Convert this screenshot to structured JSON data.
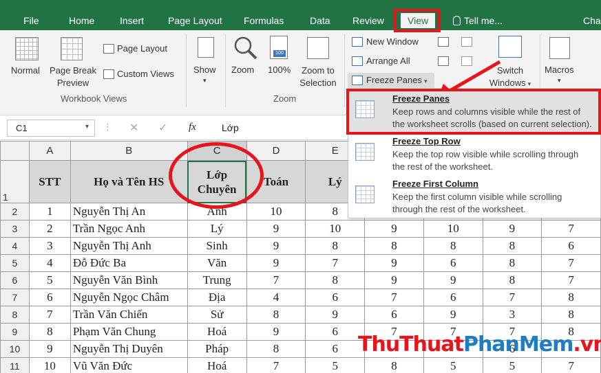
{
  "ribbon_tabs": [
    {
      "label": "File"
    },
    {
      "label": "Home"
    },
    {
      "label": "Insert"
    },
    {
      "label": "Page Layout"
    },
    {
      "label": "Formulas"
    },
    {
      "label": "Data"
    },
    {
      "label": "Review"
    },
    {
      "label": "View"
    },
    {
      "label": "Tell me..."
    },
    {
      "label": "Cha"
    }
  ],
  "workbook_views": {
    "normal": "Normal",
    "page_break_preview_line1": "Page Break",
    "page_break_preview_line2": "Preview",
    "page_layout": "Page Layout",
    "custom_views": "Custom Views",
    "group_label": "Workbook Views"
  },
  "show_group": {
    "show": "Show"
  },
  "zoom_group": {
    "zoom": "Zoom",
    "zoom_100": "100%",
    "zoom_to_selection_line1": "Zoom to",
    "zoom_to_selection_line2": "Selection",
    "group_label": "Zoom",
    "badge_100": "100"
  },
  "window_group": {
    "new_window": "New Window",
    "arrange_all": "Arrange All",
    "freeze_panes": "Freeze Panes",
    "switch_windows_line1": "Switch",
    "switch_windows_line2": "Windows"
  },
  "macros_group": {
    "macros": "Macros"
  },
  "formula_bar": {
    "name_box": "C1",
    "fx_label": "fx",
    "formula_value": "Lớp"
  },
  "freeze_menu": {
    "items": [
      {
        "title": "Freeze Panes",
        "desc1": "Keep rows and columns visible while the rest of",
        "desc2": "the worksheet scrolls (based on current selection)."
      },
      {
        "title": "Freeze Top Row",
        "desc1": "Keep the top row visible while scrolling through",
        "desc2": "the rest of the worksheet."
      },
      {
        "title": "Freeze First Column",
        "desc1": "Keep the first column visible while scrolling",
        "desc2": "through the rest of the worksheet."
      }
    ]
  },
  "sheet": {
    "columns": [
      "A",
      "B",
      "C",
      "D",
      "E",
      "F",
      "G",
      "H",
      "I"
    ],
    "header_row": {
      "stt": "STT",
      "name": "Họ và Tên HS",
      "class_line1": "Lớp",
      "class_line2": "Chuyên",
      "math": "Toán",
      "physics": "Lý"
    },
    "rows": [
      {
        "num": "2",
        "stt": "1",
        "name": "Nguyễn Thị An",
        "cls": "Anh",
        "d": "10",
        "e": "8",
        "f": "",
        "g": "",
        "h": "",
        "i": ""
      },
      {
        "num": "3",
        "stt": "2",
        "name": "Trần Ngọc Anh",
        "cls": "Lý",
        "d": "9",
        "e": "10",
        "f": "9",
        "g": "10",
        "h": "9",
        "i": "7"
      },
      {
        "num": "4",
        "stt": "3",
        "name": "Nguyễn Thị Anh",
        "cls": "Sinh",
        "d": "9",
        "e": "8",
        "f": "8",
        "g": "8",
        "h": "8",
        "i": "6"
      },
      {
        "num": "5",
        "stt": "4",
        "name": "Đỗ Đức Ba",
        "cls": "Văn",
        "d": "9",
        "e": "7",
        "f": "9",
        "g": "6",
        "h": "8",
        "i": "7"
      },
      {
        "num": "6",
        "stt": "5",
        "name": "Nguyễn Văn Bình",
        "cls": "Trung",
        "d": "7",
        "e": "8",
        "f": "9",
        "g": "9",
        "h": "8",
        "i": "7"
      },
      {
        "num": "7",
        "stt": "6",
        "name": "Nguyễn Ngọc Châm",
        "cls": "Địa",
        "d": "4",
        "e": "6",
        "f": "7",
        "g": "6",
        "h": "7",
        "i": "8"
      },
      {
        "num": "8",
        "stt": "7",
        "name": "Trần Văn Chiến",
        "cls": "Sử",
        "d": "8",
        "e": "9",
        "f": "6",
        "g": "9",
        "h": "3",
        "i": "8"
      },
      {
        "num": "9",
        "stt": "8",
        "name": "Phạm Văn Chung",
        "cls": "Hoá",
        "d": "9",
        "e": "6",
        "f": "7",
        "g": "7",
        "h": "7",
        "i": "8"
      },
      {
        "num": "10",
        "stt": "9",
        "name": "Nguyễn Thị Duyên",
        "cls": "Pháp",
        "d": "8",
        "e": "6",
        "f": "",
        "g": "",
        "h": "6",
        "i": ""
      },
      {
        "num": "11",
        "stt": "10",
        "name": "Vũ Văn Đức",
        "cls": "Hoá",
        "d": "7",
        "e": "5",
        "f": "8",
        "g": "5",
        "h": "5",
        "i": "7"
      }
    ]
  },
  "watermark": {
    "part1": "ThuThuat",
    "part2": "PhanMem",
    "part3": ".vn"
  },
  "colors": {
    "excel_green": "#217346",
    "annotation_red": "#e8141b",
    "watermark_red": "#e8141b",
    "watermark_blue": "#1c7cc4"
  }
}
